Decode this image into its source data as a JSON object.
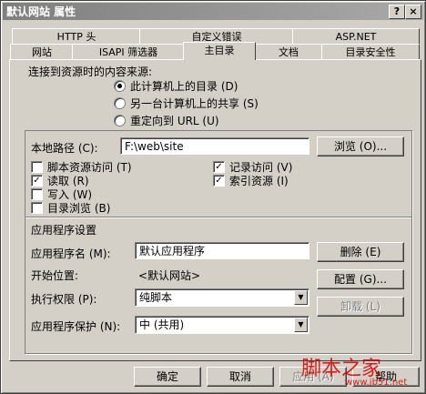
{
  "window": {
    "title": "默认网站 属性",
    "help_btn": "?",
    "close_btn": "×"
  },
  "tabs_row1": [
    "HTTP 头",
    "自定义错误",
    "ASP.NET"
  ],
  "tabs_row2": [
    "网站",
    "ISAPI 筛选器",
    "主目录",
    "文档",
    "目录安全性"
  ],
  "content_source": {
    "label": "连接到资源时的内容来源:",
    "options": [
      "此计算机上的目录 (D)",
      "另一台计算机上的共享 (S)",
      "重定向到 URL (U)"
    ],
    "selected_index": 0
  },
  "local_path": {
    "label": "本地路径 (C):",
    "value": "F:\\web\\site",
    "browse_label": "浏览 (O)..."
  },
  "checkboxes": [
    {
      "label": "脚本资源访问 (T)",
      "checked": false
    },
    {
      "label": "读取 (R)",
      "checked": true
    },
    {
      "label": "写入 (W)",
      "checked": false
    },
    {
      "label": "目录浏览 (B)",
      "checked": false
    },
    {
      "label": "记录访问 (V)",
      "checked": true
    },
    {
      "label": "索引资源 (I)",
      "checked": true
    }
  ],
  "app_settings": {
    "section_label": "应用程序设置",
    "app_name_label": "应用程序名 (M):",
    "app_name_value": "默认应用程序",
    "remove_label": "删除 (E)",
    "start_label": "开始位置:",
    "start_value": "<默认网站>",
    "config_label": "配置 (G)...",
    "exec_label": "执行权限 (P):",
    "exec_value": "纯脚本",
    "unload_label": "卸载 (L)",
    "protection_label": "应用程序保护 (N):",
    "protection_value": "中 (共用)"
  },
  "footer": {
    "ok": "确定",
    "cancel": "取消",
    "apply": "应用 (A)",
    "help": "帮助"
  },
  "watermark": {
    "text": "脚本之家",
    "url": "www.jb51.net"
  }
}
